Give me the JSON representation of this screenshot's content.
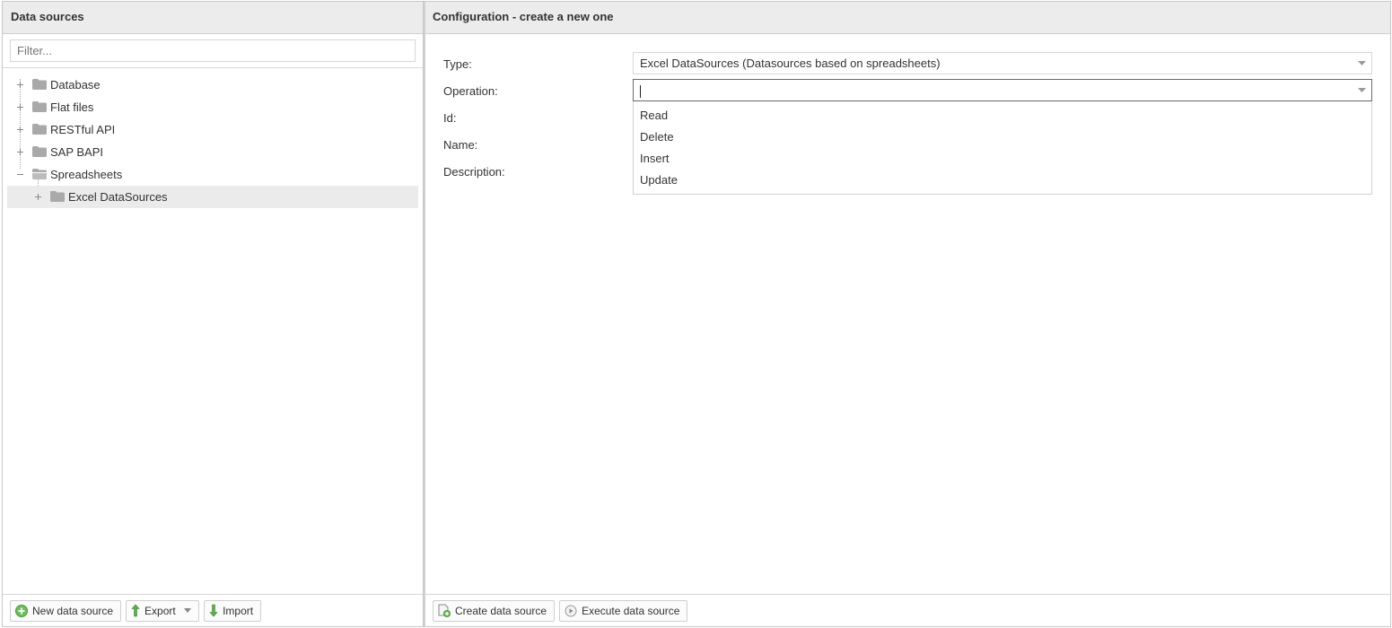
{
  "left_panel": {
    "title": "Data sources",
    "filter_placeholder": "Filter...",
    "tree": [
      {
        "label": "Database",
        "expanded": false,
        "icon": "folder-icon"
      },
      {
        "label": "Flat files",
        "expanded": false,
        "icon": "folder-icon"
      },
      {
        "label": "RESTful API",
        "expanded": false,
        "icon": "folder-icon"
      },
      {
        "label": "SAP BAPI",
        "expanded": false,
        "icon": "folder-icon"
      },
      {
        "label": "Spreadsheets",
        "expanded": true,
        "icon": "folder-icon",
        "children": [
          {
            "label": "Excel DataSources",
            "expanded": false,
            "selected": true,
            "icon": "folder-icon"
          }
        ]
      }
    ],
    "footer": {
      "new_label": "New data source",
      "export_label": "Export",
      "import_label": "Import"
    }
  },
  "right_panel": {
    "title": "Configuration - create a new one",
    "form": {
      "type_label": "Type:",
      "type_value": "Excel DataSources (Datasources based on spreadsheets)",
      "operation_label": "Operation:",
      "operation_value": "",
      "operation_options": [
        "Read",
        "Delete",
        "Insert",
        "Update"
      ],
      "id_label": "Id:",
      "name_label": "Name:",
      "description_label": "Description:"
    },
    "footer": {
      "create_label": "Create data source",
      "execute_label": "Execute data source"
    }
  },
  "colors": {
    "header_bg": "#ececec",
    "selected_bg": "#ebebeb",
    "folder": "#a8a8a8",
    "add_green": "#5cb85c",
    "arrow_green": "#3c9a3c"
  }
}
